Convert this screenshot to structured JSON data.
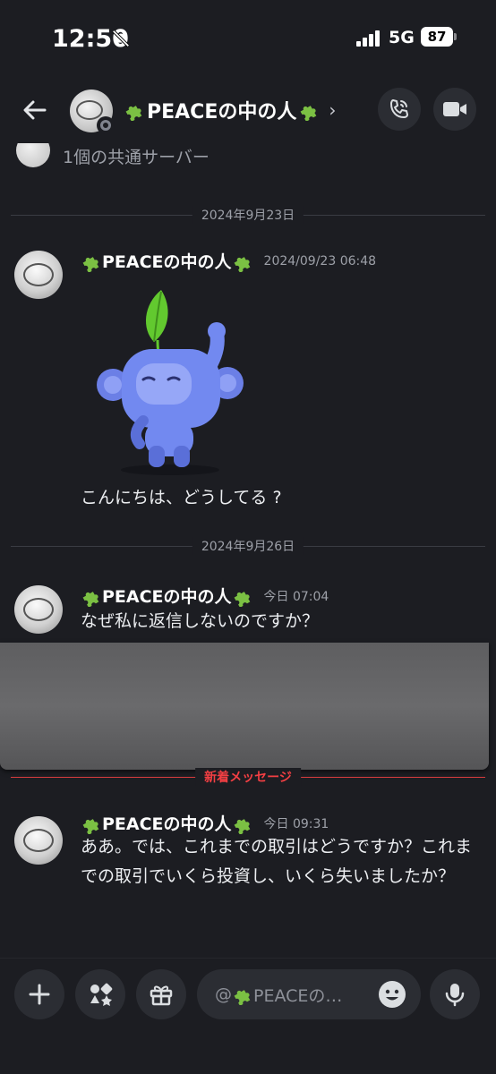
{
  "status_bar": {
    "time": "12:50",
    "network": "5G",
    "battery": "87"
  },
  "header": {
    "title_name": "PEACEの中の人",
    "chevron": "›"
  },
  "chat": {
    "common_server_text": "1個の共通サーバー",
    "date_divider_1": "2024年9月23日",
    "date_divider_2": "2024年9月26日",
    "new_messages_divider": "新着メッセージ",
    "messages": [
      {
        "author": "PEACEの中の人",
        "time": "2024/09/23 06:48",
        "text": "こんにちは、どうしてる ?"
      },
      {
        "author": "PEACEの中の人",
        "time": "今日 07:04",
        "text": "なぜ私に返信しないのですか？"
      },
      {
        "author": "PEACEの中の人",
        "time": "今日 09:31",
        "text": "ああ。では、これまでの取引はどうですか？これまでの取引でいくら投資し、いくら失いましたか？"
      }
    ]
  },
  "composer": {
    "placeholder_prefix": "@",
    "placeholder_name": "PEACEの…"
  },
  "icons": {
    "puzzle_color": "#7bc043",
    "wumpus_color": "#7289f0",
    "leaf_color": "#62c92f",
    "new_divider_color": "#f23f43"
  }
}
